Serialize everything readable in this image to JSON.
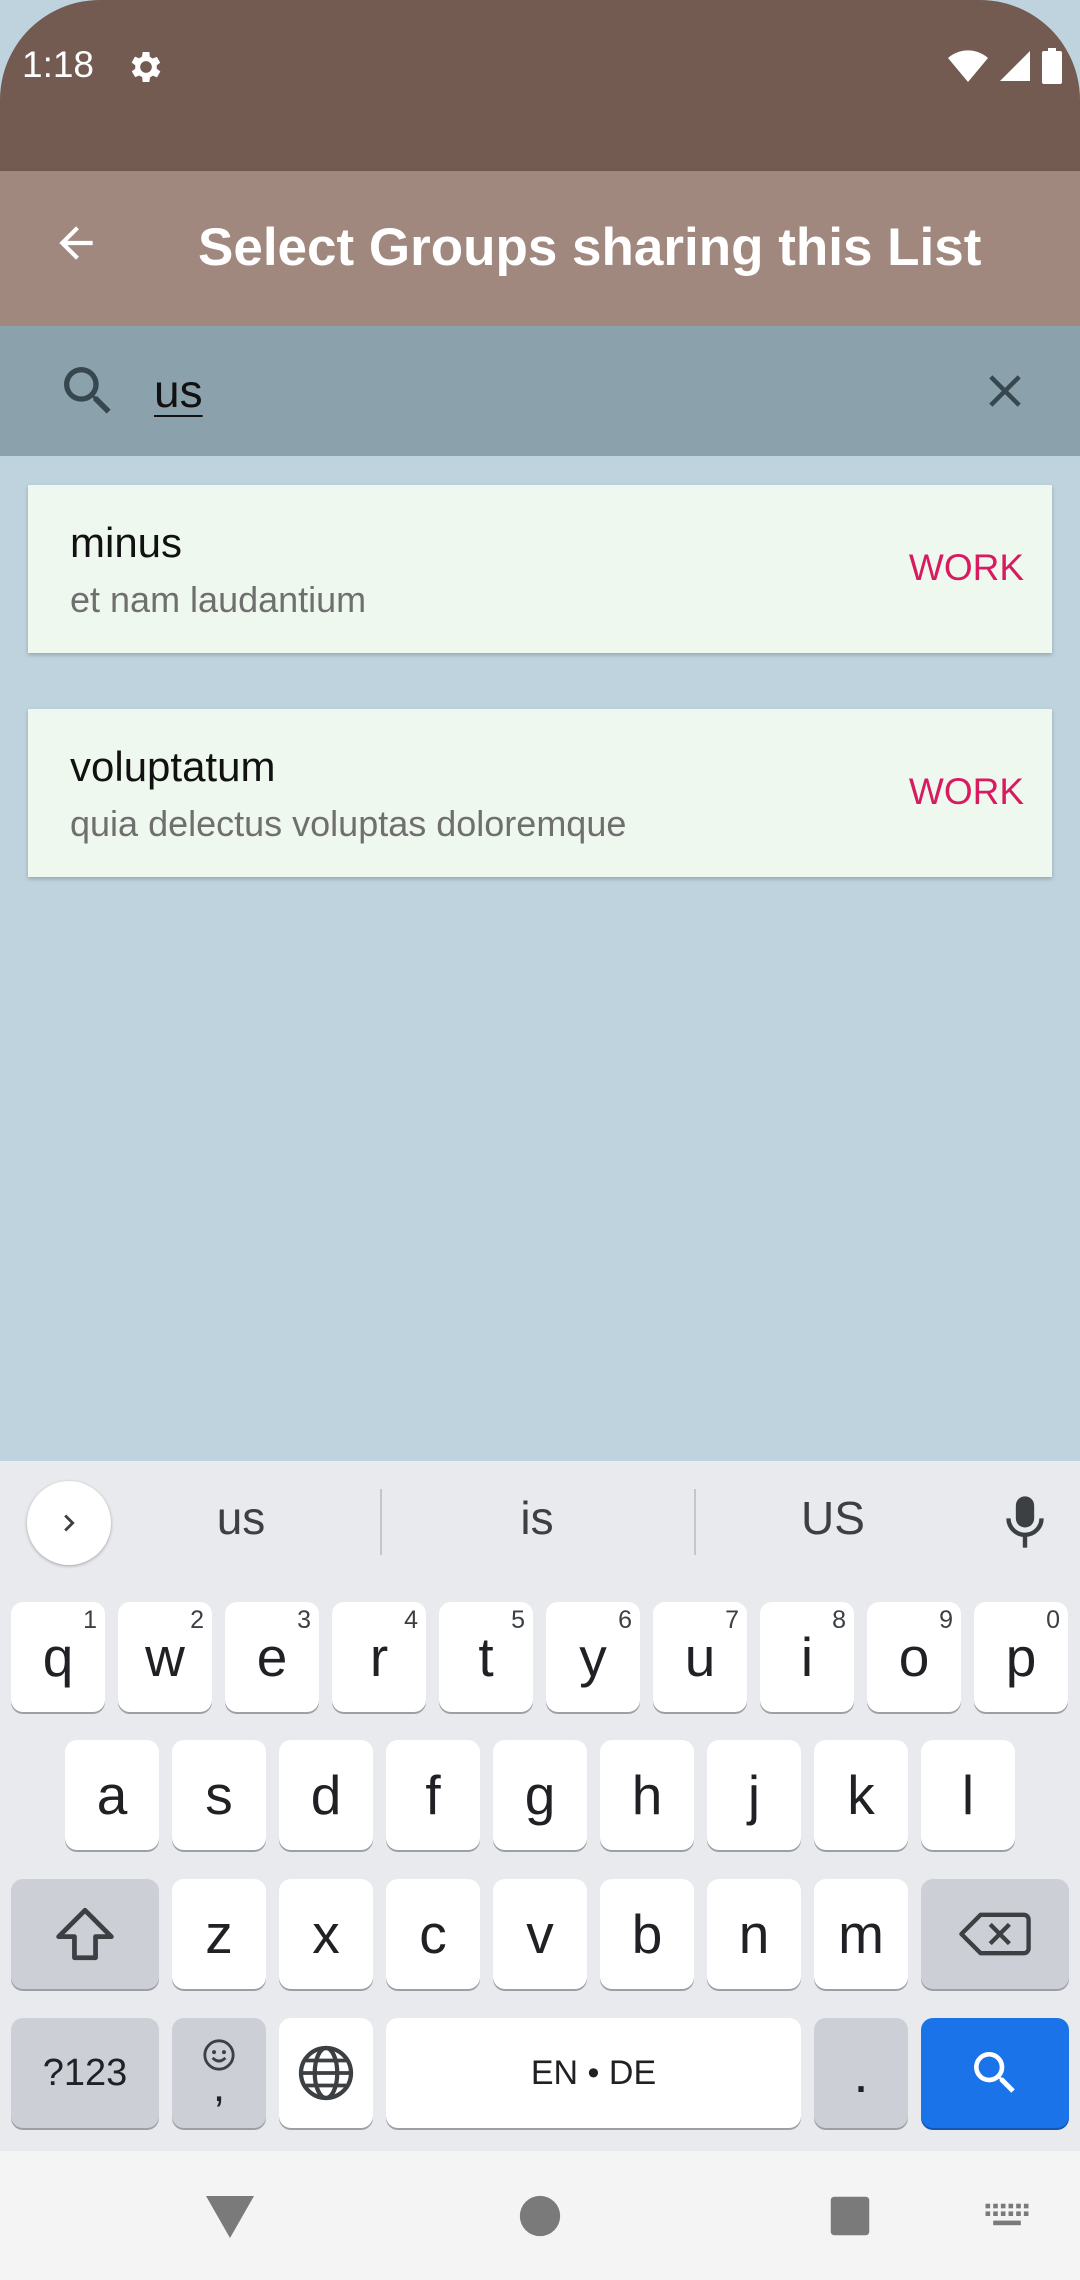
{
  "status_bar": {
    "time": "1:18"
  },
  "app_bar": {
    "title": "Select Groups sharing this List"
  },
  "search": {
    "query": "us"
  },
  "results": [
    {
      "title": "minus",
      "subtitle": "et nam laudantium",
      "badge": "WORK"
    },
    {
      "title": "voluptatum",
      "subtitle": "quia delectus voluptas doloremque",
      "badge": "WORK"
    }
  ],
  "keyboard": {
    "suggestions": [
      "us",
      "is",
      "US"
    ],
    "row1": [
      {
        "key": "q",
        "hint": "1"
      },
      {
        "key": "w",
        "hint": "2"
      },
      {
        "key": "e",
        "hint": "3"
      },
      {
        "key": "r",
        "hint": "4"
      },
      {
        "key": "t",
        "hint": "5"
      },
      {
        "key": "y",
        "hint": "6"
      },
      {
        "key": "u",
        "hint": "7"
      },
      {
        "key": "i",
        "hint": "8"
      },
      {
        "key": "o",
        "hint": "9"
      },
      {
        "key": "p",
        "hint": "0"
      }
    ],
    "row2": [
      "a",
      "s",
      "d",
      "f",
      "g",
      "h",
      "j",
      "k",
      "l"
    ],
    "row3": [
      "z",
      "x",
      "c",
      "v",
      "b",
      "n",
      "m"
    ],
    "symbols_label": "?123",
    "comma_label": ",",
    "space_label": "EN • DE",
    "period_label": "."
  },
  "colors": {
    "status_bar": "#735b52",
    "app_bar": "#a1887f",
    "search_bar": "#8ba1ab",
    "background": "#bfd3de",
    "card": "#eff8ef",
    "badge": "#d81b60",
    "keyboard_action": "#1a73e8"
  }
}
